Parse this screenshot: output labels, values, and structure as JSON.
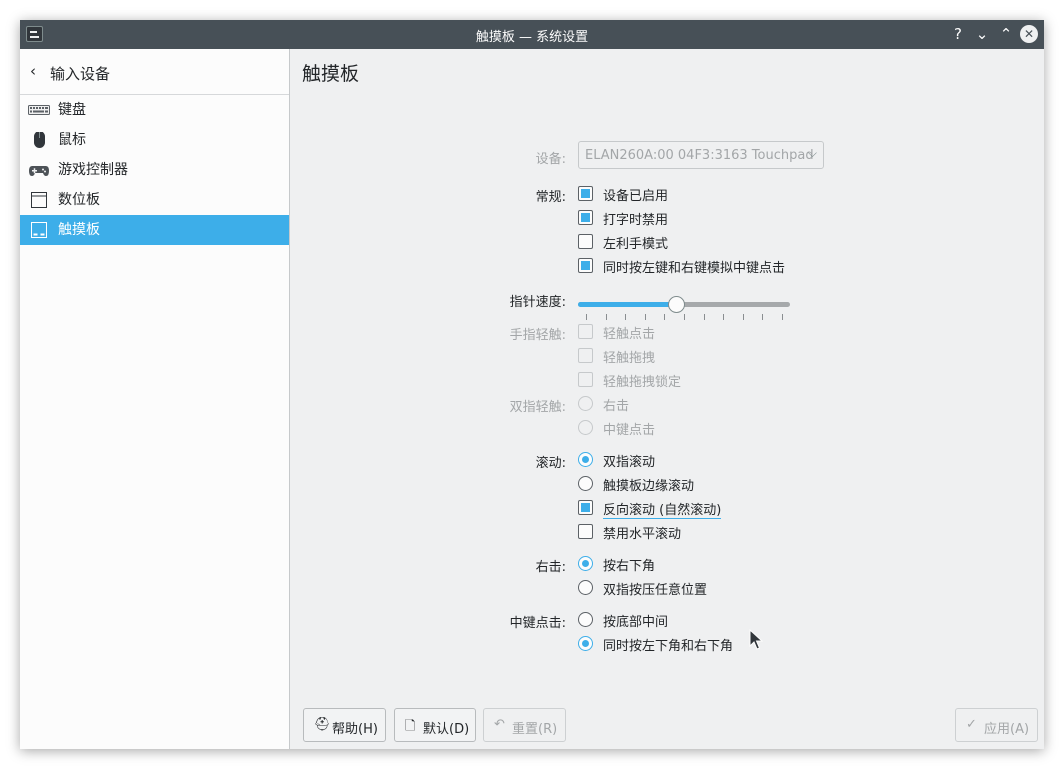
{
  "window": {
    "title": "触摸板 — 系统设置"
  },
  "titlebar": {
    "help_glyph": "?",
    "minimize_glyph": "⌄",
    "maximize_glyph": "⌃",
    "close_glyph": "✕"
  },
  "sidebar": {
    "back_glyph": "‹",
    "title": "输入设备",
    "items": [
      {
        "label": "键盘"
      },
      {
        "label": "鼠标"
      },
      {
        "label": "游戏控制器"
      },
      {
        "label": "数位板"
      },
      {
        "label": "触摸板"
      }
    ]
  },
  "page": {
    "title": "触摸板"
  },
  "form": {
    "device": {
      "label": "设备:",
      "value": "ELAN260A:00 04F3:3163 Touchpad",
      "arrow": "⌵"
    },
    "general": {
      "label": "常规:",
      "options": [
        {
          "text": "设备已启用",
          "checked": true
        },
        {
          "text": "打字时禁用",
          "checked": true
        },
        {
          "text": "左利手模式",
          "checked": false
        },
        {
          "text": "同时按左键和右键模拟中键点击",
          "checked": true
        }
      ]
    },
    "pointer_speed": {
      "label": "指针速度:",
      "value_fraction": 0.5,
      "tick_count": 11
    },
    "tap": {
      "label": "手指轻触:",
      "options": [
        {
          "text": "轻触点击",
          "checked": false
        },
        {
          "text": "轻触拖拽",
          "checked": false
        },
        {
          "text": "轻触拖拽锁定",
          "checked": false
        }
      ]
    },
    "two_finger_tap": {
      "label": "双指轻触:",
      "options": [
        {
          "text": "右击",
          "checked": false
        },
        {
          "text": "中键点击",
          "checked": false
        }
      ]
    },
    "scrolling": {
      "label": "滚动:",
      "options": [
        {
          "text": "双指滚动",
          "checked": true
        },
        {
          "text": "触摸板边缘滚动",
          "checked": false
        },
        {
          "text": "反向滚动 (自然滚动)",
          "checked": true
        },
        {
          "text": "禁用水平滚动",
          "checked": false
        }
      ]
    },
    "right_click": {
      "label": "右击:",
      "options": [
        {
          "text": "按右下角",
          "checked": true
        },
        {
          "text": "双指按压任意位置",
          "checked": false
        }
      ]
    },
    "middle_click": {
      "label": "中键点击:",
      "options": [
        {
          "text": "按底部中间",
          "checked": false
        },
        {
          "text": "同时按左下角和右下角",
          "checked": true
        }
      ]
    }
  },
  "buttons": {
    "help": {
      "icon": "⛑",
      "label": "帮助(H)"
    },
    "defaults": {
      "icon": "🗋",
      "label": "默认(D)"
    },
    "reset": {
      "icon": "↶",
      "label": "重置(R)"
    },
    "apply": {
      "icon": "✓",
      "label": "应用(A)"
    }
  },
  "colors": {
    "accent": "#3daee9",
    "titlebar": "#475057",
    "window_bg": "#eff0f1",
    "disabled_text": "#a3a6a8"
  }
}
